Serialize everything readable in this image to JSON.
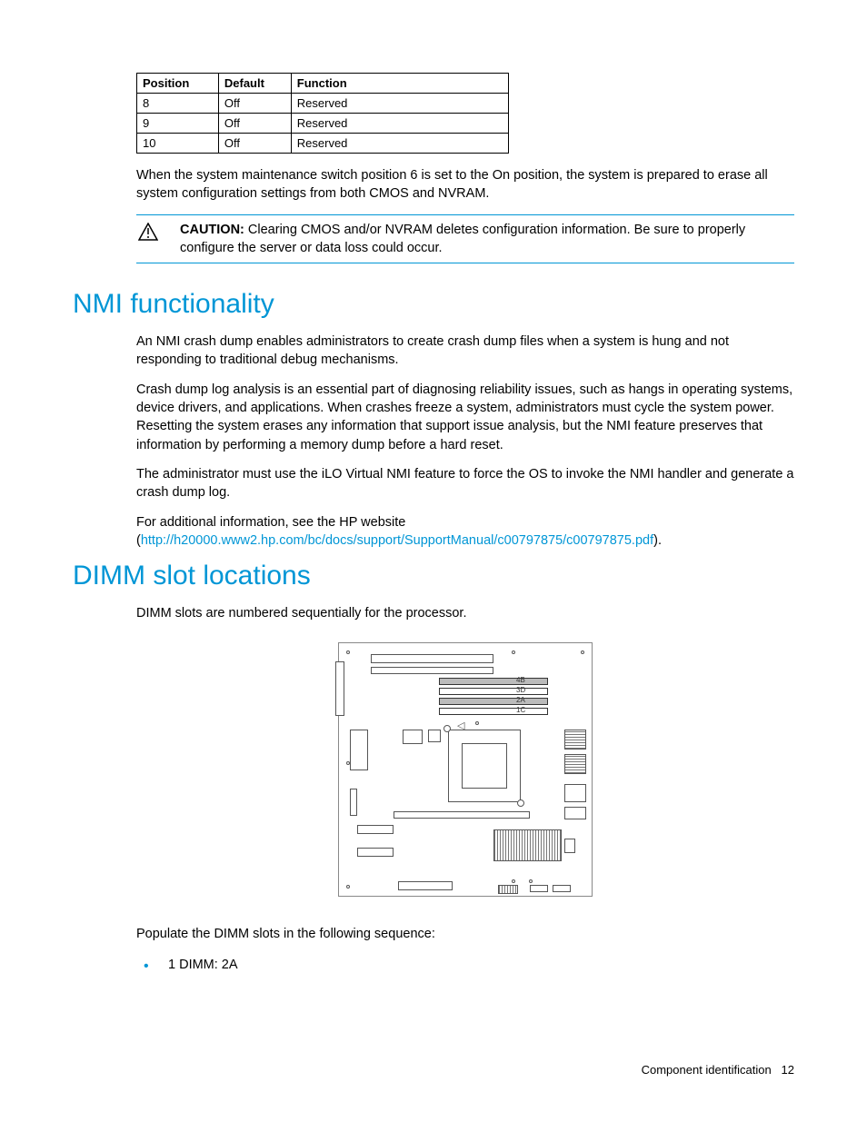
{
  "table": {
    "headers": {
      "position": "Position",
      "default": "Default",
      "function": "Function"
    },
    "rows": [
      {
        "position": "8",
        "default": "Off",
        "function": "Reserved"
      },
      {
        "position": "9",
        "default": "Off",
        "function": "Reserved"
      },
      {
        "position": "10",
        "default": "Off",
        "function": "Reserved"
      }
    ]
  },
  "maintenance_note": "When the system maintenance switch position 6 is set to the On position, the system is prepared to erase all system configuration settings from both CMOS and NVRAM.",
  "caution": {
    "label": "CAUTION:",
    "text": "Clearing CMOS and/or NVRAM deletes configuration information. Be sure to properly configure the server or data loss could occur."
  },
  "nmi": {
    "heading": "NMI functionality",
    "p1": "An NMI crash dump enables administrators to create crash dump files when a system is hung and not responding to traditional debug mechanisms.",
    "p2": "Crash dump log analysis is an essential part of diagnosing reliability issues, such as hangs in operating systems, device drivers, and applications. When crashes freeze a system, administrators must cycle the system power. Resetting the system erases any information that support issue analysis, but the NMI feature preserves that information by performing a memory dump before a hard reset.",
    "p3": "The administrator must use the iLO Virtual NMI feature to force the OS to invoke the NMI handler and generate a crash dump log.",
    "p4_pre": "For additional information, see the HP website (",
    "p4_link": "http://h20000.www2.hp.com/bc/docs/support/SupportManual/c00797875/c00797875.pdf",
    "p4_post": ")."
  },
  "dimm": {
    "heading": "DIMM slot locations",
    "intro": "DIMM slots are numbered sequentially for the processor.",
    "labels": {
      "4b": "4B",
      "3d": "3D",
      "2a": "2A",
      "1c": "1C"
    },
    "populate": "Populate the DIMM slots in the following sequence:",
    "items": [
      "1 DIMM: 2A"
    ]
  },
  "footer": {
    "section": "Component identification",
    "page": "12"
  }
}
